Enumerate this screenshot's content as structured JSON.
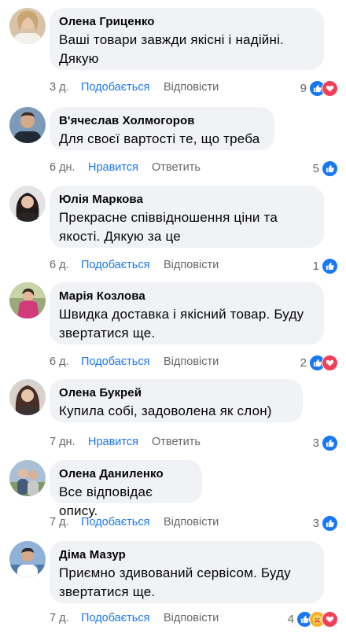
{
  "comments": [
    {
      "author": "Олена Гриценко",
      "text": "Ваші товари завжди якісні і надійні. Дякую",
      "time": "3 д.",
      "like_label": "Подобається",
      "reply_label": "Відповісти",
      "reaction_count": "9",
      "reactions": [
        "like-icon",
        "love-icon"
      ],
      "avatar_color": "#c9a98a"
    },
    {
      "author": "В'ячеслав Холмогоров",
      "text": "Для своєї вартості те, що треба",
      "time": "6 дн.",
      "like_label": "Нравится",
      "reply_label": "Ответить",
      "reaction_count": "5",
      "reactions": [
        "like-icon"
      ],
      "avatar_color": "#5c7fa0"
    },
    {
      "author": "Юлія Маркова",
      "text": "Прекрасне співвідношення ціни та якості. Дякую за це",
      "time": "6 д.",
      "like_label": "Подобається",
      "reply_label": "Відповісти",
      "reaction_count": "1",
      "reactions": [
        "like-icon"
      ],
      "avatar_color": "#3a3030"
    },
    {
      "author": "Марія Козлова",
      "text": "Швидка доставка і якісний товар. Буду звертатися ще.",
      "time": "6 д.",
      "like_label": "Подобається",
      "reply_label": "Відповісти",
      "reaction_count": "2",
      "reactions": [
        "like-icon",
        "love-icon"
      ],
      "avatar_color": "#b8416a"
    },
    {
      "author": "Олена Букрей",
      "text": "Купила собі, задоволена як слон)",
      "time": "7 дн.",
      "like_label": "Нравится",
      "reply_label": "Ответить",
      "reaction_count": "3",
      "reactions": [
        "like-icon"
      ],
      "avatar_color": "#4a3a34"
    },
    {
      "author": "Олена Даниленко",
      "text": "Все відповідає опису.",
      "time": "7 д.",
      "like_label": "Подобається",
      "reply_label": "Відповісти",
      "reaction_count": "3",
      "reactions": [
        "like-icon"
      ],
      "avatar_color": "#8aa1b8"
    },
    {
      "author": "Діма Мазур",
      "text": "Приємно здивований сервісом. Буду звертатися ще.",
      "time": "7 д.",
      "like_label": "Подобається",
      "reply_label": "Відповісти",
      "reaction_count": "4",
      "reactions": [
        "like-icon",
        "care-icon",
        "love-icon"
      ],
      "avatar_color": "#6f8fb0"
    }
  ],
  "colors": {
    "bubble": "#f0f2f5",
    "like_link": "#1877f2",
    "secondary_text": "#65676b",
    "like_reaction": "#1877f2",
    "love_reaction": "#f33e58",
    "care_reaction": "#f7b125"
  }
}
